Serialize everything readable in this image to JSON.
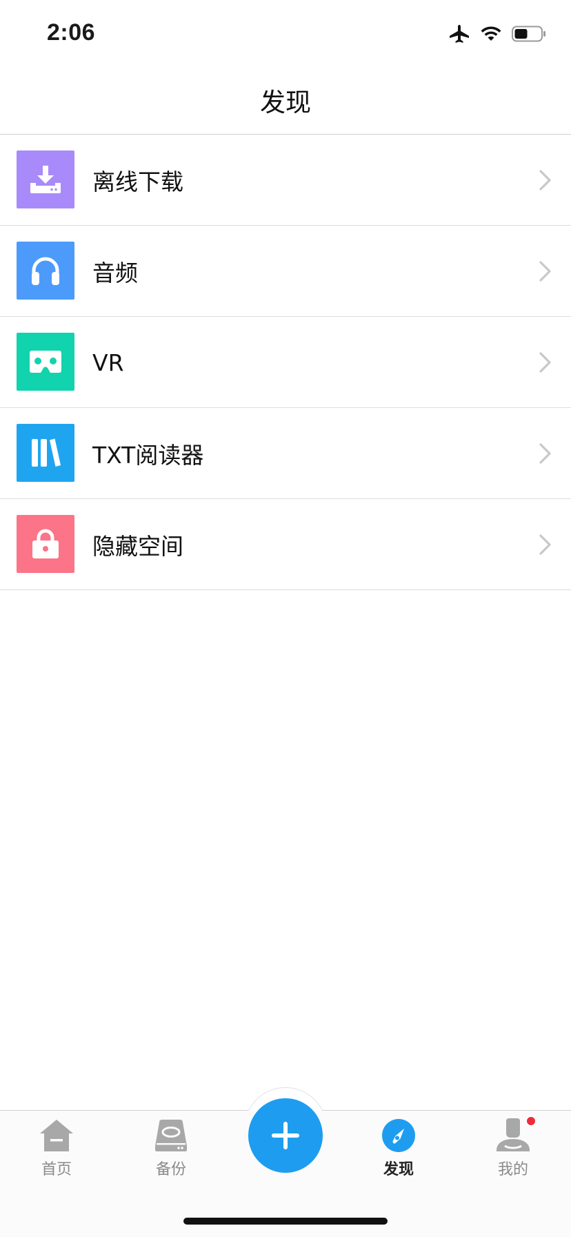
{
  "status_bar": {
    "time": "2:06",
    "icons": [
      "airplane-icon",
      "wifi-icon",
      "battery-icon"
    ]
  },
  "header": {
    "title": "发现"
  },
  "menu": {
    "items": [
      {
        "label": "离线下载",
        "icon": "download-icon",
        "color": "#a98afa"
      },
      {
        "label": "音频",
        "icon": "headphones-icon",
        "color": "#4c9bfb"
      },
      {
        "label": "VR",
        "icon": "vr-headset-icon",
        "color": "#11d3ad"
      },
      {
        "label": "TXT阅读器",
        "icon": "books-icon",
        "color": "#1fa5f0"
      },
      {
        "label": "隐藏空间",
        "icon": "lock-icon",
        "color": "#fb7487"
      }
    ]
  },
  "tab_bar": {
    "tabs": [
      {
        "label": "首页",
        "icon": "home-icon",
        "active": false
      },
      {
        "label": "备份",
        "icon": "hard-drive-icon",
        "active": false
      },
      {
        "label": "发现",
        "icon": "compass-icon",
        "active": true
      },
      {
        "label": "我的",
        "icon": "user-icon",
        "active": false,
        "badge": true
      }
    ],
    "fab_icon": "plus-icon"
  },
  "colors": {
    "accent": "#1e9df0",
    "badge": "#ee2b3d"
  }
}
